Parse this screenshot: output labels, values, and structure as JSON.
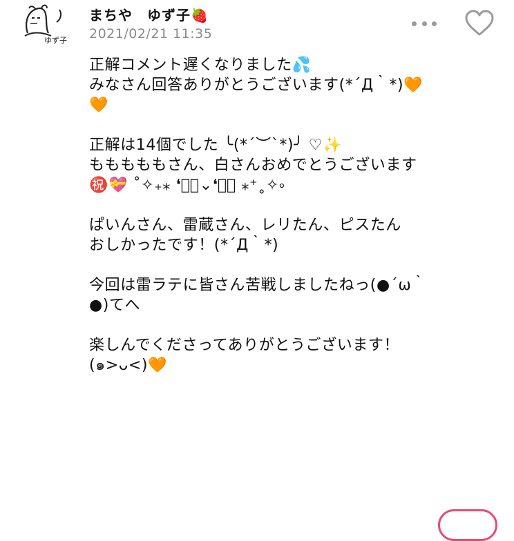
{
  "post": {
    "author": "まちや　ゆず子🍓",
    "timestamp": "2021/02/21 11:35",
    "lines": [
      "正解コメント遅くなりました💦",
      "みなさん回答ありがとうございます(*´Д｀*)🧡",
      "🧡",
      "",
      "正解は14個でした ╰(*´︶`*)╯ ♡✨",
      "もももももさん、白さんおめでとうございます",
      "㊗️💝 ˚✧₊⁎ ❛ัั⌄❛ัั ⁎⁺˳✧༚",
      "",
      "ぱいんさん、雷蔵さん、レリたん、ピスたん",
      "おしかったです！(*´Д｀*)",
      "",
      "今回は雷ラテに皆さん苦戦しましたねっ(●´ω｀",
      "●)てへ",
      "",
      "楽しんでくださってありがとうございます！",
      "(๑>ᴗ<)🧡"
    ]
  },
  "icons": {
    "avatar": "sketch-avatar",
    "more": "more-icon",
    "like": "heart-outline-icon"
  },
  "colors": {
    "heart_outline": "#9b9b9b",
    "timestamp": "#8a8a8a",
    "accent_pink": "#e84a75"
  }
}
